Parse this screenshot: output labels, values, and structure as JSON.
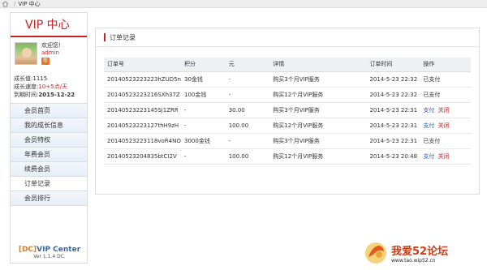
{
  "breadcrumb": {
    "current": "VIP 中心"
  },
  "sidebar": {
    "title": "VIP 中心",
    "welcome": "欢迎您!",
    "username": "admin",
    "year_badge": "年",
    "growth_value_label": "成长值:",
    "growth_value": "1115",
    "growth_speed_label": "成长速度:",
    "growth_speed": "10+5点/天",
    "expire_label": "到期时间:",
    "expire_date": "2015-12-22",
    "menu": [
      {
        "label": "会员首页"
      },
      {
        "label": "我的成长信息"
      },
      {
        "label": "会员特权"
      },
      {
        "label": "年费会员"
      },
      {
        "label": "续费会员"
      },
      {
        "label": "订单记录"
      },
      {
        "label": "会员排行"
      }
    ],
    "footer_brand": "[DC]",
    "footer_title": "VIP Center",
    "footer_version": "Ver 1.1.4 DC."
  },
  "main": {
    "title": "订单记录",
    "columns": [
      "订单号",
      "积分",
      "元",
      "详情",
      "订单时间",
      "操作"
    ],
    "rows": [
      {
        "id": "20140523223223hZUD5n",
        "points": "30金钱",
        "yuan": "-",
        "detail": "购买3个月VIP服务",
        "time": "2014-5-23 22:32",
        "status": "已支付"
      },
      {
        "id": "20140523223216SXh37Z",
        "points": "100金钱",
        "yuan": "-",
        "detail": "购买12个月VIP服务",
        "time": "2014-5-23 22:32",
        "status": "已支付"
      },
      {
        "id": "20140523223145Sj1ZRR",
        "points": "-",
        "yuan": "30.00",
        "detail": "购买3个月VIP服务",
        "time": "2014-5-23 22:31",
        "pay": "支付",
        "close": "关闭"
      },
      {
        "id": "20140523223127thH9zH",
        "points": "-",
        "yuan": "100.00",
        "detail": "购买12个月VIP服务",
        "time": "2014-5-23 22:31",
        "pay": "支付",
        "close": "关闭"
      },
      {
        "id": "20140523223118voR4NO",
        "points": "3000金钱",
        "yuan": "-",
        "detail": "购买3个月VIP服务",
        "time": "2014-5-23 22:31",
        "status": "已支付"
      },
      {
        "id": "20140523204835btCI2V",
        "points": "-",
        "yuan": "100.00",
        "detail": "购买12个月VIP服务",
        "time": "2014-5-23 20:48",
        "pay": "支付",
        "close": "关闭"
      }
    ]
  },
  "watermark": {
    "text": "我爱52论坛",
    "url": "www.tao.wip52.cn"
  },
  "colors": {
    "accent": "#cc1f1f",
    "link": "#2a62b8",
    "menu_bg": "#e9f0f8"
  }
}
